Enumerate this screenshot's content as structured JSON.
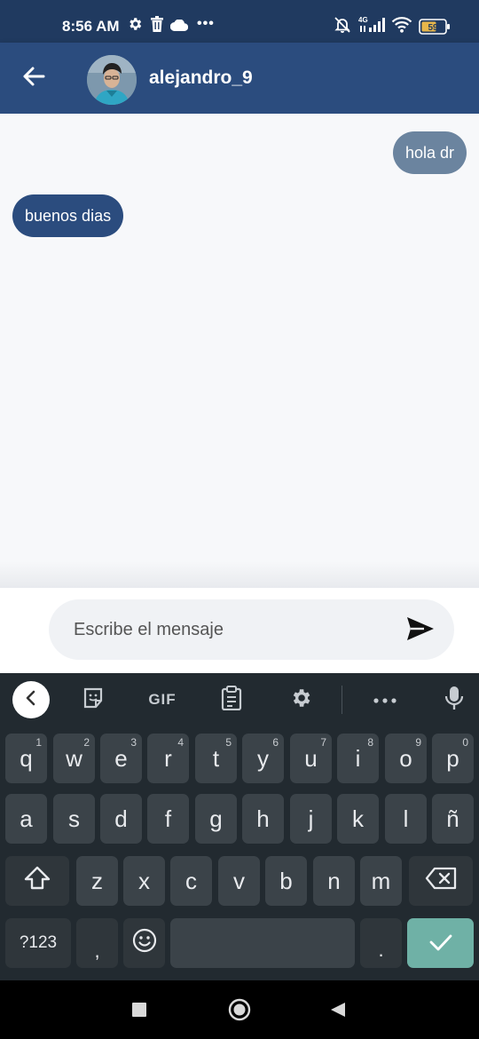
{
  "status_bar": {
    "time": "8:56 AM",
    "network_label": "4G",
    "battery": "59",
    "left_icons": [
      "gear-icon",
      "trash-icon",
      "cloud-icon",
      "more-dots-icon"
    ],
    "right_icons": [
      "alarm-off-icon",
      "signal-icon",
      "wifi-icon",
      "battery-icon"
    ]
  },
  "header": {
    "username": "alejandro_9",
    "background_color": "#2b4c7e"
  },
  "messages": [
    {
      "direction": "sent",
      "text": "hola dr",
      "color": "#6b849f"
    },
    {
      "direction": "received",
      "text": "buenos dias",
      "color": "#2b4c7e"
    }
  ],
  "compose": {
    "placeholder": "Escribe el mensaje",
    "value": ""
  },
  "keyboard": {
    "toolbar": {
      "gif_label": "GIF",
      "icons": [
        "chevron-left-icon",
        "sticker-icon",
        "clipboard-icon",
        "gear-icon",
        "more-dots-icon",
        "mic-icon"
      ]
    },
    "row1": [
      {
        "label": "q",
        "hint": "1"
      },
      {
        "label": "w",
        "hint": "2"
      },
      {
        "label": "e",
        "hint": "3"
      },
      {
        "label": "r",
        "hint": "4"
      },
      {
        "label": "t",
        "hint": "5"
      },
      {
        "label": "y",
        "hint": "6"
      },
      {
        "label": "u",
        "hint": "7"
      },
      {
        "label": "i",
        "hint": "8"
      },
      {
        "label": "o",
        "hint": "9"
      },
      {
        "label": "p",
        "hint": "0"
      }
    ],
    "row2": [
      "a",
      "s",
      "d",
      "f",
      "g",
      "h",
      "j",
      "k",
      "l",
      "ñ"
    ],
    "row3": [
      "z",
      "x",
      "c",
      "v",
      "b",
      "n",
      "m"
    ],
    "row4": {
      "symbols_label": "?123",
      "comma_label": ",",
      "period_label": "."
    },
    "enter_color": "#6fb1a6"
  },
  "nav_bar": {
    "icons": [
      "recents-square-icon",
      "home-circle-icon",
      "back-triangle-icon"
    ]
  }
}
